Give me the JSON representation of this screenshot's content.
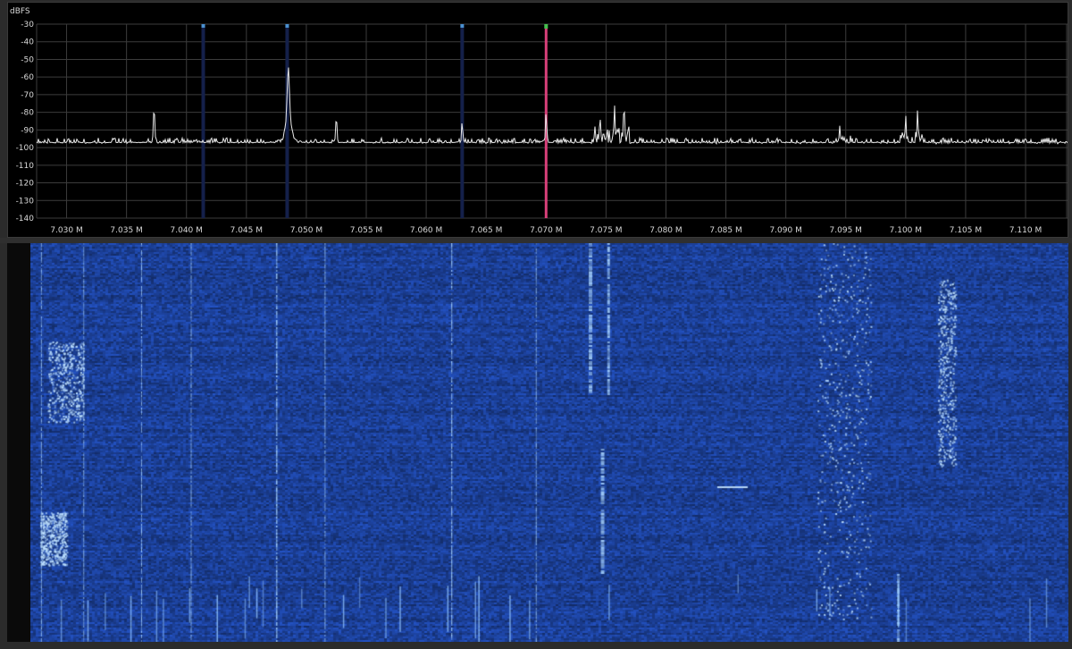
{
  "spectrum": {
    "y_unit": "dBFS",
    "y_ticks": [
      "-30",
      "-40",
      "-50",
      "-60",
      "-70",
      "-80",
      "-90",
      "-100",
      "-110",
      "-120",
      "-130",
      "-140"
    ],
    "x_ticks": [
      "7.030 M",
      "7.035 M",
      "7.040 M",
      "7.045 M",
      "7.050 M",
      "7.055 M",
      "7.060 M",
      "7.065 M",
      "7.070 M",
      "7.075 M",
      "7.080 M",
      "7.085 M",
      "7.090 M",
      "7.095 M",
      "7.100 M",
      "7.105 M",
      "7.110 M"
    ]
  },
  "chart_data": {
    "type": "line",
    "ylabel": "dBFS",
    "xlim": [
      7.0275,
      7.1135
    ],
    "ylim": [
      -140,
      -30
    ],
    "grid": true,
    "noise_floor_dbfs": -98,
    "peaks": [
      {
        "freq_mhz": 7.0373,
        "level_dbfs": -71
      },
      {
        "freq_mhz": 7.0485,
        "level_dbfs": -55
      },
      {
        "freq_mhz": 7.0525,
        "level_dbfs": -78
      },
      {
        "freq_mhz": 7.063,
        "level_dbfs": -83
      },
      {
        "freq_mhz": 7.07,
        "level_dbfs": -78
      },
      {
        "freq_mhz": 7.0745,
        "level_dbfs": -80
      },
      {
        "freq_mhz": 7.0757,
        "level_dbfs": -73
      },
      {
        "freq_mhz": 7.0765,
        "level_dbfs": -71
      },
      {
        "freq_mhz": 7.0945,
        "level_dbfs": -87
      },
      {
        "freq_mhz": 7.1,
        "level_dbfs": -82
      },
      {
        "freq_mhz": 7.101,
        "level_dbfs": -77
      }
    ],
    "markers": [
      {
        "freq_mhz": 7.0414,
        "color": "#4a90d0"
      },
      {
        "freq_mhz": 7.0484,
        "color": "#4a90d0"
      },
      {
        "freq_mhz": 7.063,
        "color": "#4a90d0"
      },
      {
        "freq_mhz": 7.07,
        "color": "#e04060",
        "tuned": true
      }
    ]
  },
  "colors": {
    "trace": "#e8e8e8",
    "grid": "#3c3c3c",
    "marker_band": "#14204a",
    "tuned_marker": "#d8407a",
    "waterfall_bg": "#1e3e9e",
    "waterfall_signal": "#a8d4ff"
  }
}
